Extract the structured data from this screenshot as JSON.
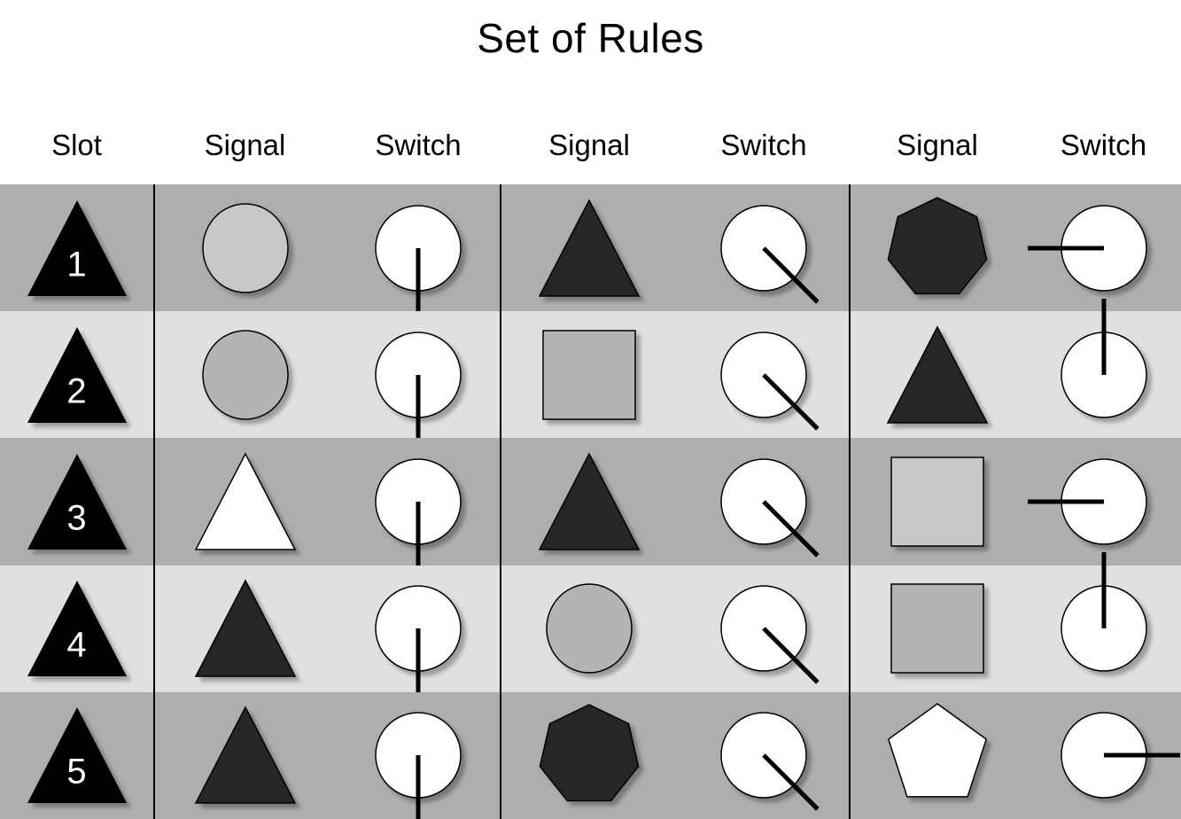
{
  "title": "Set of Rules",
  "columns": [
    {
      "label": "Slot"
    },
    {
      "label": "Signal"
    },
    {
      "label": "Switch"
    },
    {
      "label": "Signal"
    },
    {
      "label": "Switch"
    },
    {
      "label": "Signal"
    },
    {
      "label": "Switch"
    }
  ],
  "colors": {
    "row_dark": "#aeaeae",
    "row_light": "#e0e0e0",
    "shape_black": "#000000",
    "shape_dark": "#262626",
    "shape_gray_light": "#c8c8c8",
    "shape_gray_mid": "#b4b4b4",
    "shape_white": "#ffffff",
    "outline": "#000000",
    "switch_face": "#ffffff",
    "switch_hand": "#000000",
    "text": "#000000",
    "slot_number": "#ffffff",
    "background": "#ffffff"
  },
  "rows": [
    {
      "slot": "1",
      "band": "dark",
      "cells": [
        {
          "type": "triangle",
          "fill": "#000000",
          "label": "1"
        },
        {
          "type": "circle",
          "fill": "#c8c8c8"
        },
        {
          "type": "switch",
          "angle": 180,
          "direction": "down"
        },
        {
          "type": "triangle",
          "fill": "#262626"
        },
        {
          "type": "switch",
          "angle": 135,
          "direction": "down-right"
        },
        {
          "type": "heptagon",
          "fill": "#262626"
        },
        {
          "type": "switch",
          "angle": 270,
          "direction": "left"
        }
      ]
    },
    {
      "slot": "2",
      "band": "light",
      "cells": [
        {
          "type": "triangle",
          "fill": "#000000",
          "label": "2"
        },
        {
          "type": "circle",
          "fill": "#b4b4b4"
        },
        {
          "type": "switch",
          "angle": 180,
          "direction": "down"
        },
        {
          "type": "square",
          "fill": "#b4b4b4"
        },
        {
          "type": "switch",
          "angle": 135,
          "direction": "down-right"
        },
        {
          "type": "triangle",
          "fill": "#262626"
        },
        {
          "type": "switch",
          "angle": 0,
          "direction": "up"
        }
      ]
    },
    {
      "slot": "3",
      "band": "dark",
      "cells": [
        {
          "type": "triangle",
          "fill": "#000000",
          "label": "3"
        },
        {
          "type": "triangle",
          "fill": "#ffffff"
        },
        {
          "type": "switch",
          "angle": 180,
          "direction": "down"
        },
        {
          "type": "triangle",
          "fill": "#262626"
        },
        {
          "type": "switch",
          "angle": 135,
          "direction": "down-right"
        },
        {
          "type": "square",
          "fill": "#c8c8c8"
        },
        {
          "type": "switch",
          "angle": 270,
          "direction": "left"
        }
      ]
    },
    {
      "slot": "4",
      "band": "light",
      "cells": [
        {
          "type": "triangle",
          "fill": "#000000",
          "label": "4"
        },
        {
          "type": "triangle",
          "fill": "#262626"
        },
        {
          "type": "switch",
          "angle": 180,
          "direction": "down"
        },
        {
          "type": "circle",
          "fill": "#b4b4b4"
        },
        {
          "type": "switch",
          "angle": 135,
          "direction": "down-right"
        },
        {
          "type": "square",
          "fill": "#b4b4b4"
        },
        {
          "type": "switch",
          "angle": 0,
          "direction": "up"
        }
      ]
    },
    {
      "slot": "5",
      "band": "dark",
      "cells": [
        {
          "type": "triangle",
          "fill": "#000000",
          "label": "5"
        },
        {
          "type": "triangle",
          "fill": "#262626"
        },
        {
          "type": "switch",
          "angle": 180,
          "direction": "down"
        },
        {
          "type": "heptagon",
          "fill": "#262626"
        },
        {
          "type": "switch",
          "angle": 135,
          "direction": "down-right"
        },
        {
          "type": "pentagon",
          "fill": "#ffffff"
        },
        {
          "type": "switch",
          "angle": 90,
          "direction": "right"
        }
      ]
    }
  ]
}
